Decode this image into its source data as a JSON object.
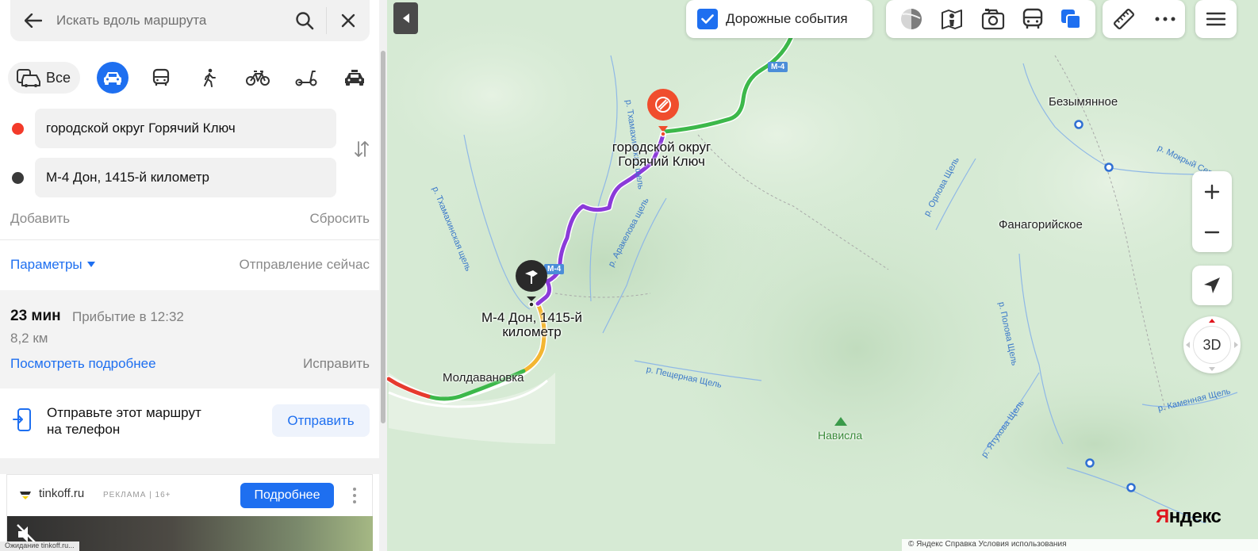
{
  "search": {
    "placeholder": "Искать вдоль маршрута"
  },
  "modes": {
    "all_label": "Все"
  },
  "route_points": {
    "from": "городской округ Горячий Ключ",
    "to": "М-4 Дон, 1415-й километр",
    "add_label": "Добавить",
    "reset_label": "Сбросить"
  },
  "options": {
    "params_label": "Параметры",
    "departure_label": "Отправление сейчас"
  },
  "route": {
    "duration": "23 мин",
    "arrival": "Прибытие в 12:32",
    "distance": "8,2 км",
    "details_link": "Посмотреть подробнее",
    "fix_link": "Исправить"
  },
  "send": {
    "text_line1": "Отправьте этот маршрут",
    "text_line2": "на телефон",
    "button": "Отправить"
  },
  "ad": {
    "domain": "tinkoff.ru",
    "tag": "РЕКЛАМА | 16+",
    "button": "Подробнее",
    "status_url": "Ожидание tinkoff.ru..."
  },
  "map_controls": {
    "traffic_label": "Дорожные события",
    "three_d": "3D",
    "zoom_in": "+",
    "zoom_out": "−"
  },
  "map": {
    "start_label_line1": "городской округ",
    "start_label_line2": "Горячий Ключ",
    "end_label_line1": "М-4 Дон, 1415-й",
    "end_label_line2": "километр",
    "road_shield": "M-4",
    "places": {
      "bezymyannoe": "Безымянное",
      "fanagoriyskoe": "Фанагорийское",
      "moldavanovka": "Молдавановка",
      "navisla": "Нависла"
    },
    "rivers": {
      "tkhamakhinskaya1": "р. Тхамахинская щель",
      "tkhamakhinskaya2": "р. Тхамахинская щель",
      "arakelova": "р. Аракелова щель",
      "orlova": "р. Орлова Щель",
      "polova": "р. Полова Щель",
      "peshchernaya": "р. Пещерная Щель",
      "yatukhova": "р. Ятухова Щель",
      "kamennaya": "р. Каменная Щель",
      "mokry": "р. Мокрый Сервиль"
    }
  },
  "brand": {
    "logo_first": "Я",
    "logo_rest": "ндекс"
  },
  "footer": {
    "text": "© Яндекс  Справка  Условия использования"
  },
  "colors": {
    "accent": "#1e6ff0",
    "route_purple": "#8b3ad9",
    "traffic_green": "#3cb84a",
    "traffic_yellow": "#f3b632",
    "traffic_red": "#e63a2e",
    "start_marker": "#f04d2d",
    "map_bg": "#d6ead4"
  }
}
